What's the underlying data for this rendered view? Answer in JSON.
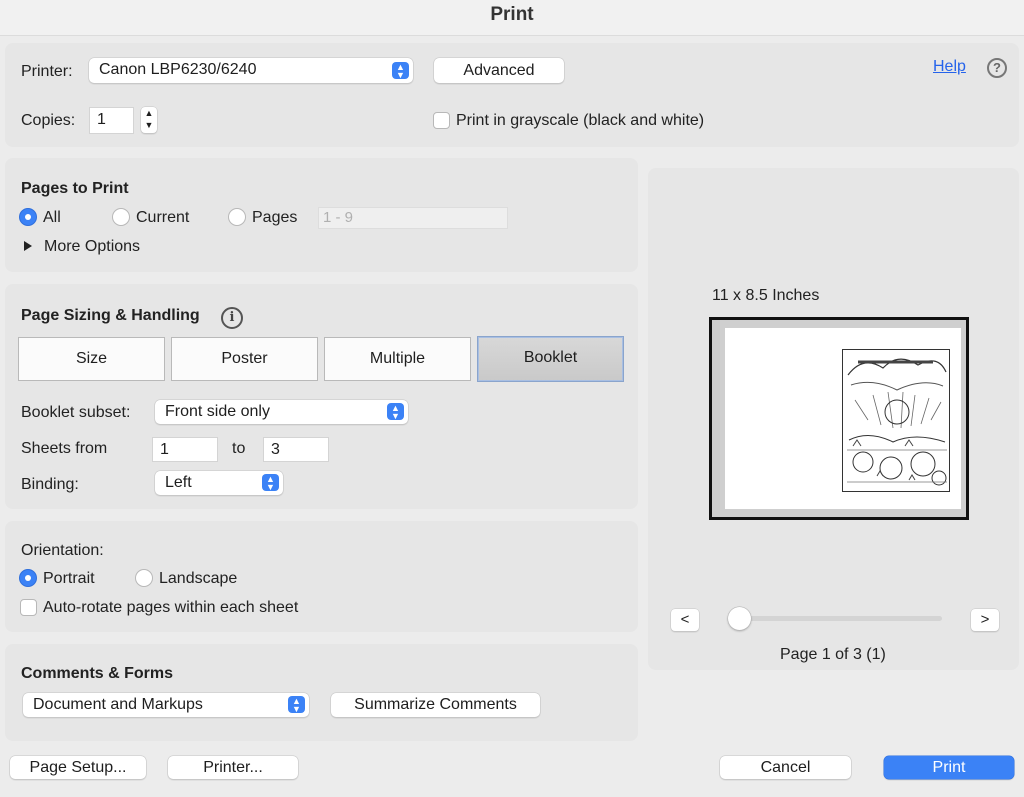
{
  "window": {
    "title": "Print"
  },
  "printer_section": {
    "printer_label": "Printer:",
    "printer_value": "Canon LBP6230/6240",
    "advanced_label": "Advanced",
    "help_label": "Help",
    "help_icon": "?",
    "copies_label": "Copies:",
    "copies_value": "1",
    "grayscale_label": "Print in grayscale (black and white)",
    "grayscale_checked": false
  },
  "pages_to_print": {
    "title": "Pages to Print",
    "options": [
      {
        "label": "All",
        "selected": true
      },
      {
        "label": "Current",
        "selected": false
      },
      {
        "label": "Pages",
        "selected": false
      }
    ],
    "pages_range_value": "1 - 9",
    "more_options_label": "More Options"
  },
  "page_sizing": {
    "title": "Page Sizing & Handling",
    "info_icon": "i",
    "tabs": [
      {
        "label": "Size",
        "active": false
      },
      {
        "label": "Poster",
        "active": false
      },
      {
        "label": "Multiple",
        "active": false
      },
      {
        "label": "Booklet",
        "active": true
      }
    ],
    "booklet_subset_label": "Booklet subset:",
    "booklet_subset_value": "Front side only",
    "sheets_from_label": "Sheets from",
    "sheets_from_value": "1",
    "sheets_to_label": "to",
    "sheets_to_value": "3",
    "binding_label": "Binding:",
    "binding_value": "Left"
  },
  "orientation": {
    "title": "Orientation:",
    "options": [
      {
        "label": "Portrait",
        "selected": true
      },
      {
        "label": "Landscape",
        "selected": false
      }
    ],
    "auto_rotate_label": "Auto-rotate pages within each sheet",
    "auto_rotate_checked": false
  },
  "comments_forms": {
    "title": "Comments & Forms",
    "value": "Document and Markups",
    "summarize_label": "Summarize Comments"
  },
  "preview": {
    "paper_size": "11 x 8.5 Inches",
    "page_info": "Page 1 of 3 (1)",
    "prev_label": "<",
    "next_label": ">",
    "page_position": 1,
    "page_count": 3
  },
  "footer": {
    "page_setup_label": "Page Setup...",
    "printer_label": "Printer...",
    "cancel_label": "Cancel",
    "print_label": "Print"
  },
  "colors": {
    "accent": "#3b82f6",
    "link": "#2563eb",
    "panel": "#e6e6e6",
    "window": "#ececec"
  }
}
